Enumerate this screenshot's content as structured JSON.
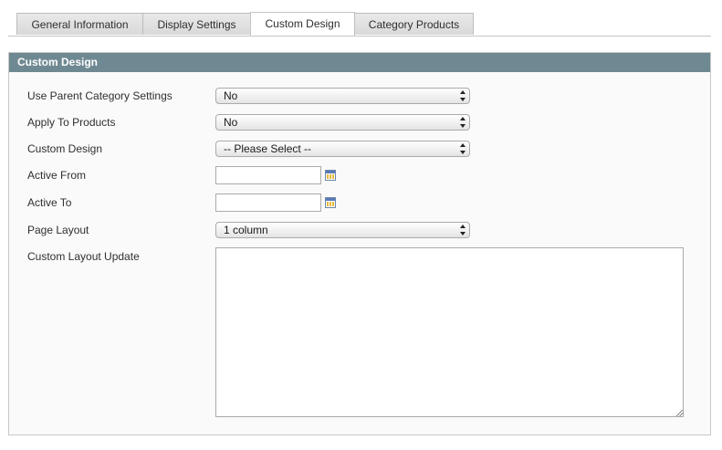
{
  "tabs": [
    {
      "label": "General Information",
      "active": false
    },
    {
      "label": "Display Settings",
      "active": false
    },
    {
      "label": "Custom Design",
      "active": true
    },
    {
      "label": "Category Products",
      "active": false
    }
  ],
  "panel": {
    "title": "Custom Design",
    "header_color": "#6f8992"
  },
  "fields": {
    "use_parent": {
      "label": "Use Parent Category Settings",
      "value": "No"
    },
    "apply_to_products": {
      "label": "Apply To Products",
      "value": "No"
    },
    "custom_design": {
      "label": "Custom Design",
      "value": "-- Please Select --"
    },
    "active_from": {
      "label": "Active From",
      "value": "",
      "icon": "calendar-icon"
    },
    "active_to": {
      "label": "Active To",
      "value": "",
      "icon": "calendar-icon"
    },
    "page_layout": {
      "label": "Page Layout",
      "value": "1 column"
    },
    "custom_layout_update": {
      "label": "Custom Layout Update",
      "value": ""
    }
  }
}
